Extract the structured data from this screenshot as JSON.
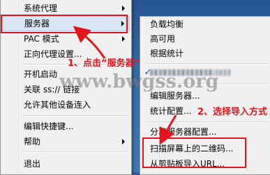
{
  "main_menu": {
    "items": [
      {
        "label": "系统代理",
        "has_submenu": true
      },
      {
        "label": "服务器",
        "has_submenu": true,
        "highlighted": true
      },
      {
        "label": "PAC 模式",
        "has_submenu": true
      },
      {
        "label": "正向代理设置..."
      },
      {
        "label": "开机启动"
      },
      {
        "label": "关联 ss:// 链接"
      },
      {
        "label": "允许其他设备连入"
      },
      {
        "label": "编辑快捷键..."
      },
      {
        "label": "帮助",
        "has_submenu": true
      },
      {
        "label": "退出"
      }
    ]
  },
  "sub_menu": {
    "items": [
      {
        "label": "负载均衡"
      },
      {
        "label": "高可用"
      },
      {
        "label": "根据统计"
      },
      {
        "label": "",
        "checked": true,
        "redacted": true
      },
      {
        "label": "编辑服务器..."
      },
      {
        "label": "统计配置..."
      },
      {
        "label": "分享服务器配置..."
      },
      {
        "label": "扫描屏幕上的二维码..."
      },
      {
        "label": "从剪贴板导入URL..."
      }
    ]
  },
  "annotations": {
    "step1": "1、点击“服务器”",
    "step2": "2、选择导入方式"
  },
  "watermark": "www.bwgss.org",
  "colors": {
    "annotation_red": "#e4151a",
    "menu_bg": "#f0f0f0",
    "highlight_bg": "#d9e6f5",
    "desktop": "#2f6aa8"
  }
}
